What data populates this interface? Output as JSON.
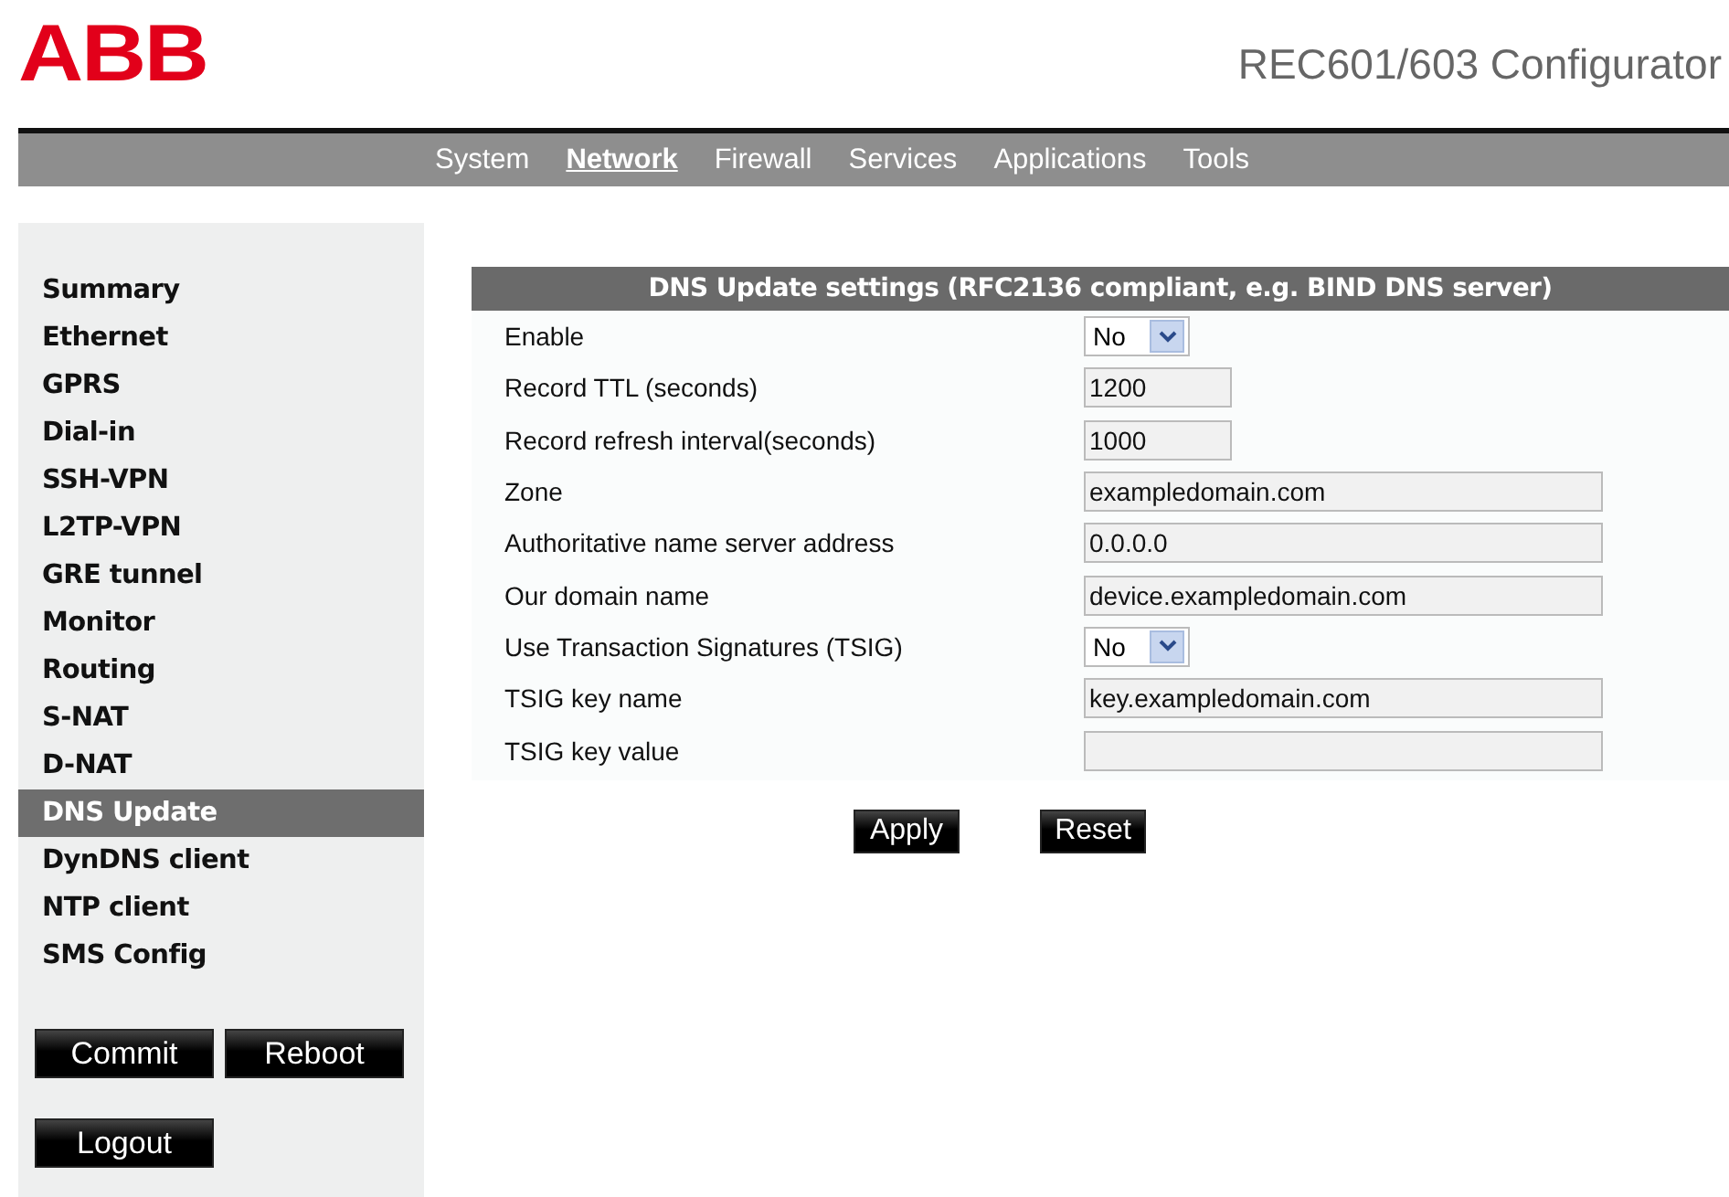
{
  "logo": "ABB",
  "title": "REC601/603 Configurator",
  "nav": [
    {
      "label": "System",
      "selected": false
    },
    {
      "label": "Network",
      "selected": true
    },
    {
      "label": "Firewall",
      "selected": false
    },
    {
      "label": "Services",
      "selected": false
    },
    {
      "label": "Applications",
      "selected": false
    },
    {
      "label": "Tools",
      "selected": false
    }
  ],
  "sidebar": {
    "items": [
      {
        "label": "Summary",
        "selected": false
      },
      {
        "label": "Ethernet",
        "selected": false
      },
      {
        "label": "GPRS",
        "selected": false
      },
      {
        "label": "Dial-in",
        "selected": false
      },
      {
        "label": "SSH-VPN",
        "selected": false
      },
      {
        "label": "L2TP-VPN",
        "selected": false
      },
      {
        "label": "GRE tunnel",
        "selected": false
      },
      {
        "label": "Monitor",
        "selected": false
      },
      {
        "label": "Routing",
        "selected": false
      },
      {
        "label": "S-NAT",
        "selected": false
      },
      {
        "label": "D-NAT",
        "selected": false
      },
      {
        "label": "DNS Update",
        "selected": true
      },
      {
        "label": "DynDNS client",
        "selected": false
      },
      {
        "label": "NTP client",
        "selected": false
      },
      {
        "label": "SMS Config",
        "selected": false
      }
    ],
    "buttons": [
      "Commit",
      "Reboot"
    ],
    "logout": "Logout"
  },
  "form": {
    "heading": "DNS Update settings (RFC2136 compliant, e.g. BIND DNS server)",
    "fields": [
      {
        "label": "Enable",
        "kind": "select",
        "value": "No"
      },
      {
        "label": "Record TTL (seconds)",
        "kind": "number",
        "value": "1200"
      },
      {
        "label": "Record refresh interval(seconds)",
        "kind": "number",
        "value": "1000"
      },
      {
        "label": "Zone",
        "kind": "text",
        "value": "exampledomain.com"
      },
      {
        "label": "Authoritative name server address",
        "kind": "text",
        "value": "0.0.0.0"
      },
      {
        "label": "Our domain name",
        "kind": "text",
        "value": "device.exampledomain.com"
      },
      {
        "label": "Use Transaction Signatures (TSIG)",
        "kind": "select",
        "value": "No"
      },
      {
        "label": "TSIG key name",
        "kind": "text",
        "value": "key.exampledomain.com"
      },
      {
        "label": "TSIG key value",
        "kind": "text"
      }
    ],
    "buttons": [
      "Apply",
      "Reset"
    ]
  }
}
